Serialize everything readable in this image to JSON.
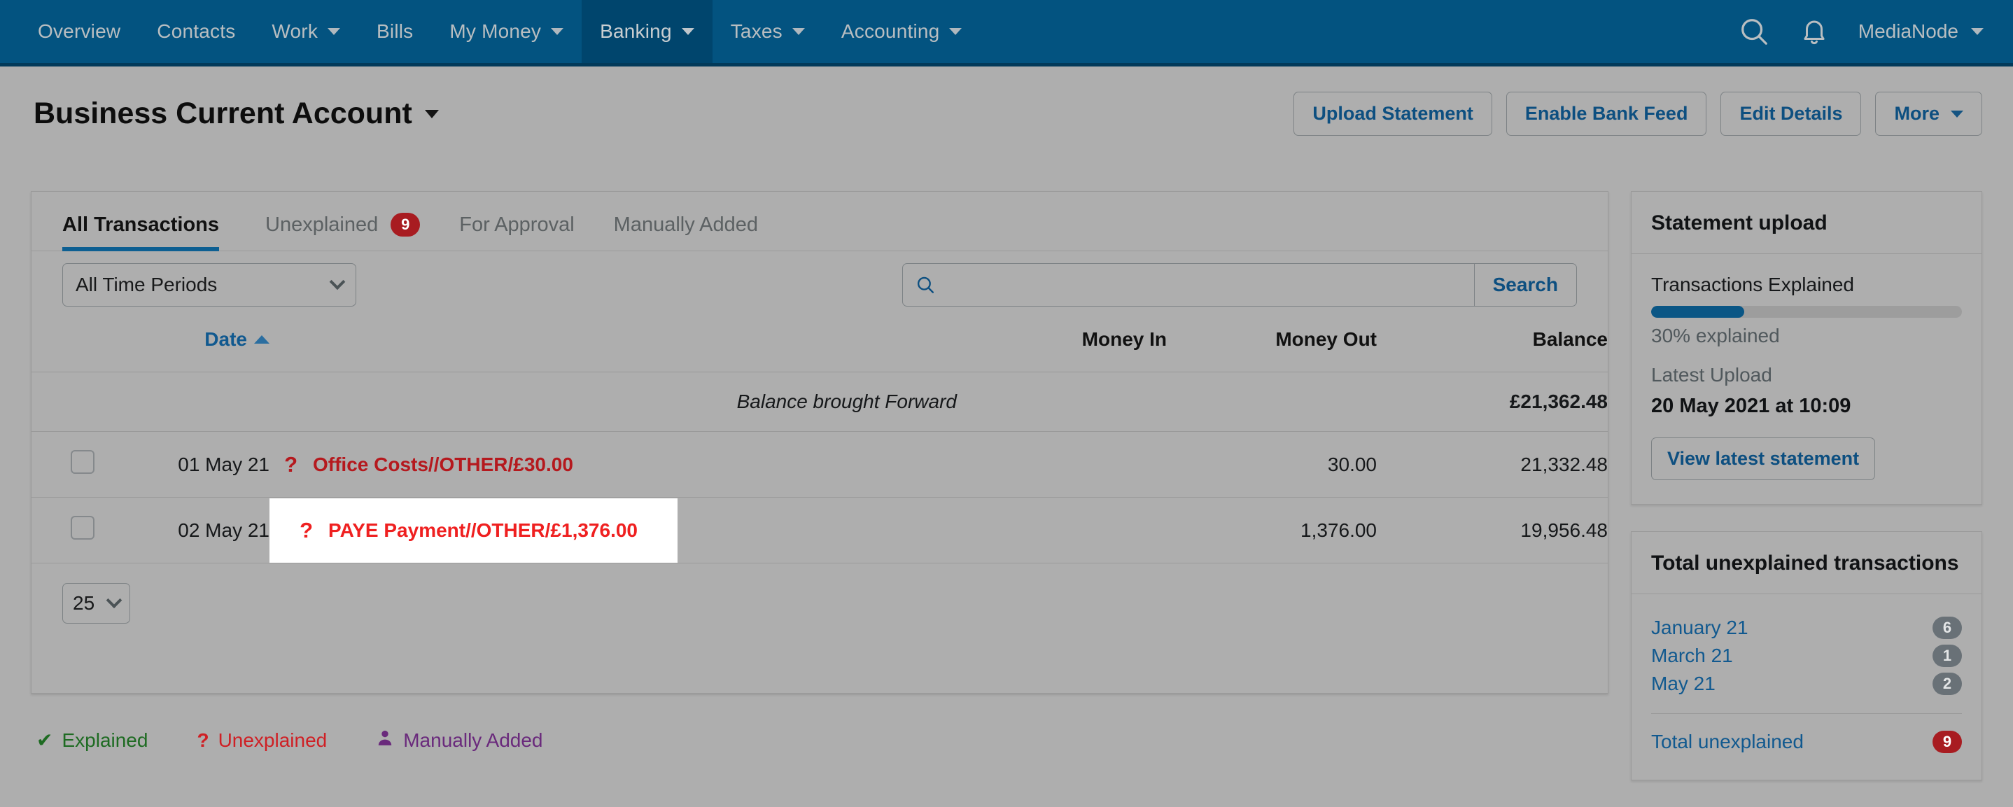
{
  "topnav": {
    "items": [
      {
        "label": "Overview",
        "has_caret": false,
        "active": false
      },
      {
        "label": "Contacts",
        "has_caret": false,
        "active": false
      },
      {
        "label": "Work",
        "has_caret": true,
        "active": false
      },
      {
        "label": "Bills",
        "has_caret": false,
        "active": false
      },
      {
        "label": "My Money",
        "has_caret": true,
        "active": false
      },
      {
        "label": "Banking",
        "has_caret": true,
        "active": true
      },
      {
        "label": "Taxes",
        "has_caret": true,
        "active": false
      },
      {
        "label": "Accounting",
        "has_caret": true,
        "active": false
      }
    ],
    "search_icon": "search-icon",
    "bell_icon": "bell-icon",
    "user_label": "MediaNode",
    "brand_color": "#035380"
  },
  "header": {
    "title": "Business Current Account",
    "actions": [
      {
        "label": "Upload Statement",
        "has_caret": false
      },
      {
        "label": "Enable Bank Feed",
        "has_caret": false
      },
      {
        "label": "Edit Details",
        "has_caret": false
      },
      {
        "label": "More",
        "has_caret": true
      }
    ]
  },
  "tabs": [
    {
      "label": "All Transactions",
      "badge": null,
      "active": true
    },
    {
      "label": "Unexplained",
      "badge": "9",
      "active": false
    },
    {
      "label": "For Approval",
      "badge": null,
      "active": false
    },
    {
      "label": "Manually Added",
      "badge": null,
      "active": false
    }
  ],
  "filters": {
    "period_value": "All Time Periods",
    "search_placeholder": "",
    "search_value": "",
    "search_button": "Search"
  },
  "table": {
    "headers": {
      "date": "Date",
      "description": "",
      "money_in": "Money In",
      "money_out": "Money Out",
      "balance": "Balance"
    },
    "sort": "asc",
    "brought_forward": {
      "label": "Balance brought Forward",
      "balance": "£21,362.48"
    },
    "rows": [
      {
        "date": "01 May 21",
        "status_icon": "?",
        "description": "Office Costs//OTHER/£30.00",
        "money_in": "",
        "money_out": "30.00",
        "balance": "21,332.48",
        "highlighted": false
      },
      {
        "date": "02 May 21",
        "status_icon": "?",
        "description": "PAYE Payment//OTHER/£1,376.00",
        "money_in": "",
        "money_out": "1,376.00",
        "balance": "19,956.48",
        "highlighted": true
      }
    ],
    "page_size": "25"
  },
  "legend": [
    {
      "icon": "✔",
      "label": "Explained",
      "color": "#1e6b22"
    },
    {
      "icon": "?",
      "label": "Unexplained",
      "color": "#cf2025"
    },
    {
      "icon": "person",
      "label": "Manually Added",
      "color": "#6a2a7c"
    }
  ],
  "sidebar": {
    "statement_upload": {
      "title": "Statement upload",
      "progress_label": "Transactions Explained",
      "progress_percent": 30,
      "progress_text": "30% explained",
      "latest_upload_label": "Latest Upload",
      "latest_upload_value": "20 May 2021 at 10:09",
      "view_button": "View latest statement",
      "progress_color": "#0a5685"
    },
    "unexplained": {
      "title": "Total unexplained transactions",
      "months": [
        {
          "label": "January 21",
          "count": "6"
        },
        {
          "label": "March 21",
          "count": "1"
        },
        {
          "label": "May 21",
          "count": "2"
        }
      ],
      "total_label": "Total unexplained",
      "total_count": "9",
      "total_color": "#a81c21"
    }
  }
}
